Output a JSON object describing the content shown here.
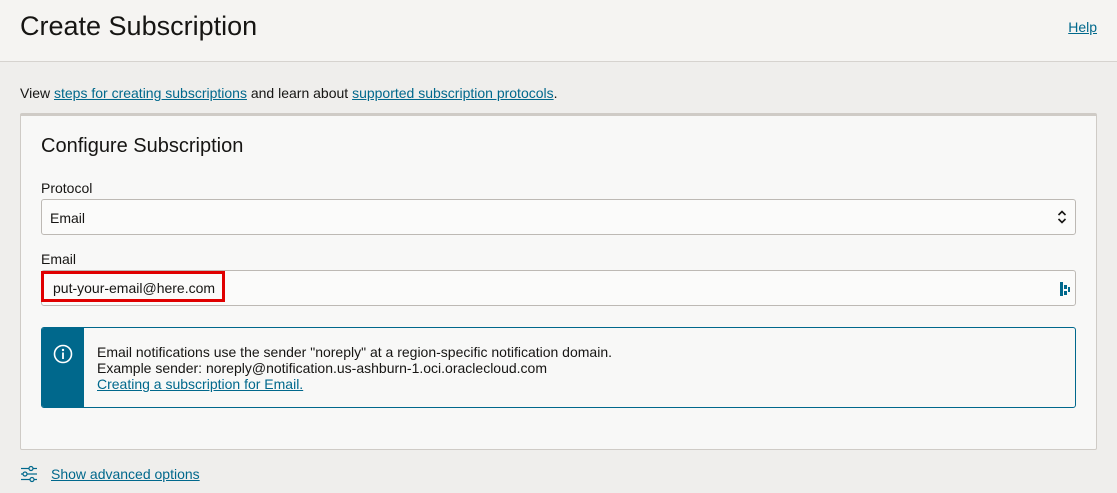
{
  "header": {
    "title": "Create Subscription",
    "help_label": "Help"
  },
  "intro": {
    "prefix": "View ",
    "steps_link": "steps for creating subscriptions",
    "middle": " and learn about ",
    "protocols_link": "supported subscription protocols",
    "suffix": "."
  },
  "panel": {
    "title": "Configure Subscription",
    "protocol": {
      "label": "Protocol",
      "selected": "Email"
    },
    "email": {
      "label": "Email",
      "value": "put-your-email@here.com",
      "placeholder": ""
    },
    "info": {
      "line1": "Email notifications use the sender \"noreply\" at a region-specific notification domain.",
      "line2": "Example sender: noreply@notification.us-ashburn-1.oci.oraclecloud.com",
      "link": "Creating a subscription for Email."
    }
  },
  "advanced": {
    "link": "Show advanced options"
  },
  "colors": {
    "accent": "#00688c",
    "highlight": "#e00000"
  },
  "icons": {
    "select": "chevron-up-down-icon",
    "input_addon": "password-manager-icon",
    "info": "info-icon",
    "advanced": "sliders-icon"
  }
}
